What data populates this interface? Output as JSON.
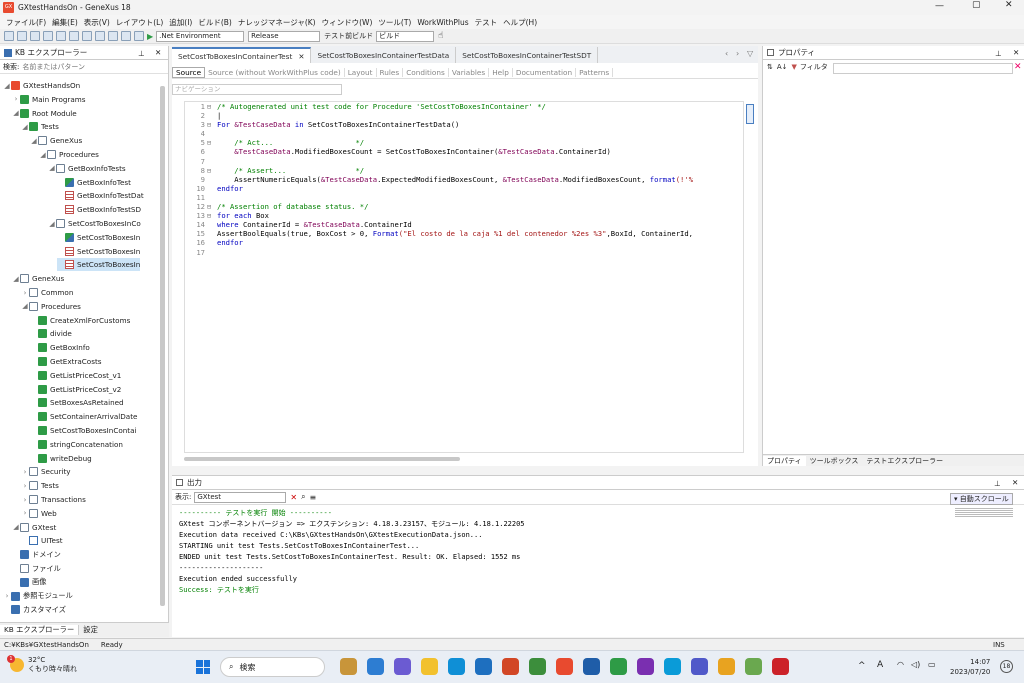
{
  "window": {
    "title": "GXtestHandsOn - GeneXus 18",
    "app_badge": "GX"
  },
  "menu": [
    "ファイル(F)",
    "編集(E)",
    "表示(V)",
    "レイアウト(L)",
    "追加(I)",
    "ビルド(B)",
    "ナレッジマネージャ(K)",
    "ウィンドウ(W)",
    "ツール(T)",
    "WorkWithPlus",
    "テスト",
    "ヘルプ(H)"
  ],
  "toolbar": {
    "environment": ".Net Environment",
    "configuration": "Release",
    "test_build_label": "テスト前ビルド",
    "build_option": "ビルド"
  },
  "kb": {
    "title": "KB エクスプローラー",
    "filter_label": "検索:",
    "filter_placeholder": "名前またはパターン",
    "tree": [
      {
        "depth": 0,
        "tw": "◢",
        "icon": "gx",
        "label": "GXtestHandsOn"
      },
      {
        "depth": 1,
        "tw": "›",
        "icon": "green",
        "label": "Main Programs"
      },
      {
        "depth": 1,
        "tw": "◢",
        "icon": "green",
        "label": "Root Module"
      },
      {
        "depth": 2,
        "tw": "◢",
        "icon": "green",
        "label": "Tests"
      },
      {
        "depth": 3,
        "tw": "◢",
        "icon": "folder",
        "label": "GeneXus"
      },
      {
        "depth": 4,
        "tw": "◢",
        "icon": "folder",
        "label": "Procedures"
      },
      {
        "depth": 5,
        "tw": "◢",
        "icon": "folder",
        "label": "GetBoxInfoTests"
      },
      {
        "depth": 6,
        "tw": "",
        "icon": "test",
        "label": "GetBoxInfoTest"
      },
      {
        "depth": 6,
        "tw": "",
        "icon": "tbl",
        "label": "GetBoxInfoTestDat"
      },
      {
        "depth": 6,
        "tw": "",
        "icon": "tbl",
        "label": "GetBoxInfoTestSD"
      },
      {
        "depth": 5,
        "tw": "◢",
        "icon": "folder",
        "label": "SetCostToBoxesInCo"
      },
      {
        "depth": 6,
        "tw": "",
        "icon": "test",
        "label": "SetCostToBoxesIn"
      },
      {
        "depth": 6,
        "tw": "",
        "icon": "tbl",
        "label": "SetCostToBoxesIn"
      },
      {
        "depth": 6,
        "tw": "",
        "icon": "tbl",
        "label": "SetCostToBoxesIn",
        "selected": true
      },
      {
        "depth": 1,
        "tw": "◢",
        "icon": "folder",
        "label": "GeneXus"
      },
      {
        "depth": 2,
        "tw": "›",
        "icon": "folder",
        "label": "Common"
      },
      {
        "depth": 2,
        "tw": "◢",
        "icon": "folder",
        "label": "Procedures"
      },
      {
        "depth": 3,
        "tw": "",
        "icon": "green",
        "label": "CreateXmlForCustoms"
      },
      {
        "depth": 3,
        "tw": "",
        "icon": "green",
        "label": "divide"
      },
      {
        "depth": 3,
        "tw": "",
        "icon": "green",
        "label": "GetBoxInfo"
      },
      {
        "depth": 3,
        "tw": "",
        "icon": "green",
        "label": "GetExtraCosts"
      },
      {
        "depth": 3,
        "tw": "",
        "icon": "green",
        "label": "GetListPriceCost_v1"
      },
      {
        "depth": 3,
        "tw": "",
        "icon": "green",
        "label": "GetListPriceCost_v2"
      },
      {
        "depth": 3,
        "tw": "",
        "icon": "green",
        "label": "SetBoxesAsRetained"
      },
      {
        "depth": 3,
        "tw": "",
        "icon": "green",
        "label": "SetContainerArrivalDate"
      },
      {
        "depth": 3,
        "tw": "",
        "icon": "green",
        "label": "SetCostToBoxesInContai"
      },
      {
        "depth": 3,
        "tw": "",
        "icon": "green",
        "label": "stringConcatenation"
      },
      {
        "depth": 3,
        "tw": "",
        "icon": "green",
        "label": "writeDebug"
      },
      {
        "depth": 2,
        "tw": "›",
        "icon": "folder",
        "label": "Security"
      },
      {
        "depth": 2,
        "tw": "›",
        "icon": "folder",
        "label": "Tests"
      },
      {
        "depth": 2,
        "tw": "›",
        "icon": "folder",
        "label": "Transactions"
      },
      {
        "depth": 2,
        "tw": "›",
        "icon": "folder",
        "label": "Web"
      },
      {
        "depth": 1,
        "tw": "◢",
        "icon": "folder",
        "label": "GXtest"
      },
      {
        "depth": 2,
        "tw": "",
        "icon": "ut",
        "label": "UITest"
      },
      {
        "depth": 1,
        "tw": "",
        "icon": "blue",
        "label": "ドメイン"
      },
      {
        "depth": 1,
        "tw": "",
        "icon": "folder",
        "label": "ファイル"
      },
      {
        "depth": 1,
        "tw": "",
        "icon": "blue",
        "label": "画像"
      },
      {
        "depth": 0,
        "tw": "›",
        "icon": "blue",
        "label": "参照モジュール"
      },
      {
        "depth": 0,
        "tw": "",
        "icon": "blue",
        "label": "カスタマイズ"
      }
    ],
    "bottom_tabs": [
      "KB エクスプローラー",
      "設定"
    ]
  },
  "editor": {
    "tabs": [
      "SetCostToBoxesInContainerTest",
      "SetCostToBoxesInContainerTestData",
      "SetCostToBoxesInContainerTestSDT"
    ],
    "subtabs": [
      "Source",
      "Source (without WorkWithPlus code)",
      "Layout",
      "Rules",
      "Conditions",
      "Variables",
      "Help",
      "Documentation",
      "Patterns"
    ],
    "nav_placeholder": "ナビゲーション",
    "lines": [
      {
        "n": "1",
        "fold": "⊟",
        "parts": [
          [
            "cm",
            "/* Autogenerated unit test code for Procedure 'SetCostToBoxesInContainer' */"
          ]
        ]
      },
      {
        "n": "2",
        "fold": "",
        "parts": [
          [
            "pl",
            "|"
          ]
        ]
      },
      {
        "n": "3",
        "fold": "⊟",
        "parts": [
          [
            "kw",
            "For "
          ],
          [
            "vr",
            "&TestCaseData"
          ],
          [
            "kw",
            " in "
          ],
          [
            "pl",
            "SetCostToBoxesInContainerTestData()"
          ]
        ]
      },
      {
        "n": "4",
        "fold": "",
        "parts": []
      },
      {
        "n": "5",
        "fold": "⊟",
        "parts": [
          [
            "cm",
            "    /* Act...                   */"
          ]
        ]
      },
      {
        "n": "6",
        "fold": "",
        "parts": [
          [
            "vr",
            "    &TestCaseData"
          ],
          [
            "pl",
            ".ModifiedBoxesCount = SetCostToBoxesInContainer("
          ],
          [
            "vr",
            "&TestCaseData"
          ],
          [
            "pl",
            ".ContainerId)"
          ]
        ]
      },
      {
        "n": "7",
        "fold": "",
        "parts": []
      },
      {
        "n": "8",
        "fold": "⊟",
        "parts": [
          [
            "cm",
            "    /* Assert...                */"
          ]
        ]
      },
      {
        "n": "9",
        "fold": "",
        "parts": [
          [
            "pl",
            "    AssertNumericEquals("
          ],
          [
            "vr",
            "&TestCaseData"
          ],
          [
            "pl",
            ".ExpectedModifiedBoxesCount, "
          ],
          [
            "vr",
            "&TestCaseData"
          ],
          [
            "pl",
            ".ModifiedBoxesCount, "
          ],
          [
            "kw",
            "format"
          ],
          [
            "st",
            "(!'%"
          ]
        ]
      },
      {
        "n": "10",
        "fold": "",
        "parts": [
          [
            "kw",
            "endfor"
          ]
        ]
      },
      {
        "n": "11",
        "fold": "",
        "parts": []
      },
      {
        "n": "12",
        "fold": "⊟",
        "parts": [
          [
            "cm",
            "/* Assertion of database status. */"
          ]
        ]
      },
      {
        "n": "13",
        "fold": "⊟",
        "parts": [
          [
            "kw",
            "for each "
          ],
          [
            "pl",
            "Box"
          ]
        ]
      },
      {
        "n": "14",
        "fold": "",
        "parts": [
          [
            "kw",
            "where "
          ],
          [
            "pl",
            "ContainerId = "
          ],
          [
            "vr",
            "&TestCaseData"
          ],
          [
            "pl",
            ".ContainerId"
          ]
        ]
      },
      {
        "n": "15",
        "fold": "",
        "parts": [
          [
            "pl",
            "AssertBoolEquals(true, BoxCost > 0, "
          ],
          [
            "kw",
            "Format"
          ],
          [
            "st",
            "(\"El costo de la caja %1 del contenedor %2es %3\""
          ],
          [
            "pl",
            ",BoxId, ContainerId,"
          ]
        ]
      },
      {
        "n": "16",
        "fold": "",
        "parts": [
          [
            "kw",
            "endfor"
          ]
        ]
      },
      {
        "n": "17",
        "fold": "",
        "parts": []
      }
    ]
  },
  "properties": {
    "title": "プロパティ",
    "filter_label": "フィルタ",
    "bottom_tabs": [
      "プロパティ",
      "ツールボックス",
      "テストエクスプローラー"
    ]
  },
  "output": {
    "title": "出力",
    "show_label": "表示:",
    "source": "GXtest",
    "autoscroll": "自動スクロール",
    "lines": [
      {
        "c": "#008000",
        "t": "---------- テストを実行 開始 ----------"
      },
      {
        "c": "#000",
        "t": "GXtest コンポーネントバージョン => エクステンション: 4.18.3.23157、モジュール: 4.18.1.22205"
      },
      {
        "c": "#000",
        "t": "Execution data received C:\\KBs\\GXtestHandsOn\\GXtestExecutionData.json..."
      },
      {
        "c": "#000",
        "t": "STARTING unit test Tests.SetCostToBoxesInContainerTest..."
      },
      {
        "c": "#000",
        "t": "ENDED unit test Tests.SetCostToBoxesInContainerTest. Result: OK. Elapsed: 1552 ms"
      },
      {
        "c": "#000",
        "t": "--------------------"
      },
      {
        "c": "#000",
        "t": "Execution ended successfully"
      },
      {
        "c": "#008000",
        "t": "Success: テストを実行"
      }
    ]
  },
  "statusbar": {
    "path": "C:¥KBs¥GXtestHandsOn",
    "state": "Ready",
    "ins": "INS"
  },
  "taskbar": {
    "temp": "32°C",
    "weather": "くもり時々晴れ",
    "search": "検索",
    "time": "14:07",
    "date": "2023/07/20",
    "badge": "18",
    "alert": "1"
  },
  "colors": {
    "accent": "#4a7fc1",
    "gx_red": "#e84a2f"
  }
}
